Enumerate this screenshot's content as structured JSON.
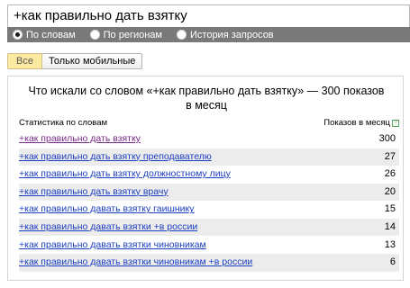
{
  "search": {
    "query": "+как правильно дать взятку"
  },
  "modes": [
    {
      "label": "По словам",
      "checked": true
    },
    {
      "label": "По регионам",
      "checked": false
    },
    {
      "label": "История запросов",
      "checked": false
    }
  ],
  "toggle": {
    "all_label": "Все",
    "mobile_label": "Только мобильные"
  },
  "panel": {
    "title": "Что искали со словом «+как правильно дать взятку» — 300 показов в месяц",
    "col_left": "Статистика по словам",
    "col_right": "Показов в месяц",
    "hint_icon": "?",
    "rows": [
      {
        "phrase": "+как правильно дать взятку",
        "count": "300"
      },
      {
        "phrase": "+как правильно дать взятку преподавателю",
        "count": "27"
      },
      {
        "phrase": "+как правильно дать взятку должностному лицу",
        "count": "26"
      },
      {
        "phrase": "+как правильно дать взятку врачу",
        "count": "20"
      },
      {
        "phrase": "+как правильно давать взятку гаишнику",
        "count": "15"
      },
      {
        "phrase": "+как правильно давать взятки +в россии",
        "count": "14"
      },
      {
        "phrase": "+как правильно давать взятки чиновникам",
        "count": "13"
      },
      {
        "phrase": "+как правильно давать взятки чиновникам +в россии",
        "count": "6"
      }
    ]
  }
}
